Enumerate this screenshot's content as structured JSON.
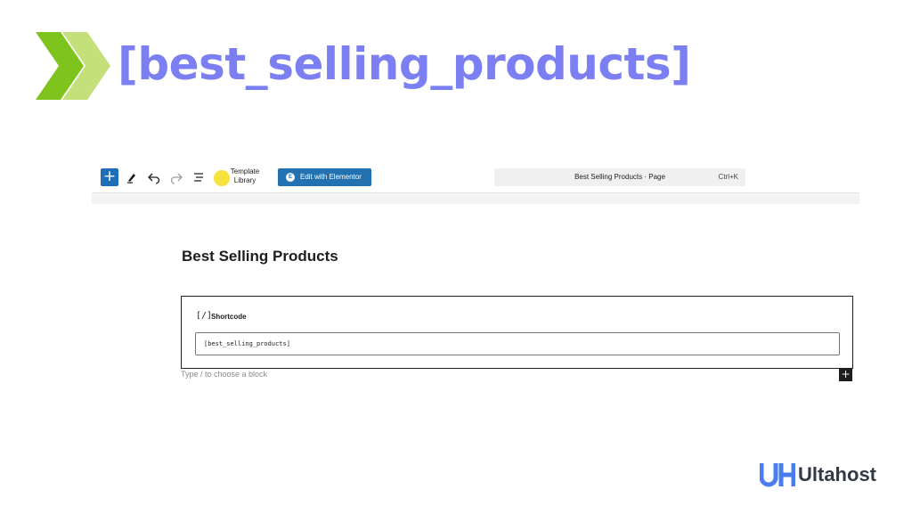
{
  "banner": {
    "title": "[best_selling_products]",
    "accent_color": "#7b7ff2",
    "chevron_colors": [
      "#7fc41d",
      "#c4e07a"
    ]
  },
  "toolbar": {
    "add_icon": "plus-icon",
    "tools": [
      "pen-icon",
      "undo-icon",
      "redo-icon",
      "list-view-icon"
    ],
    "template_library_label": "Template Library",
    "elementor_button_label": "Edit with Elementor",
    "command_bar": {
      "title": "Best Selling Products · Page",
      "shortcut": "Ctrl+K"
    }
  },
  "page": {
    "title": "Best Selling Products"
  },
  "shortcode_block": {
    "icon_label": "[/]",
    "label": "Shortcode",
    "value": "[best_selling_products]"
  },
  "editor": {
    "placeholder": "Type / to choose a block",
    "inserter_label": "+"
  },
  "branding": {
    "name": "Ultahost",
    "logo_color": "#4a7df2"
  }
}
